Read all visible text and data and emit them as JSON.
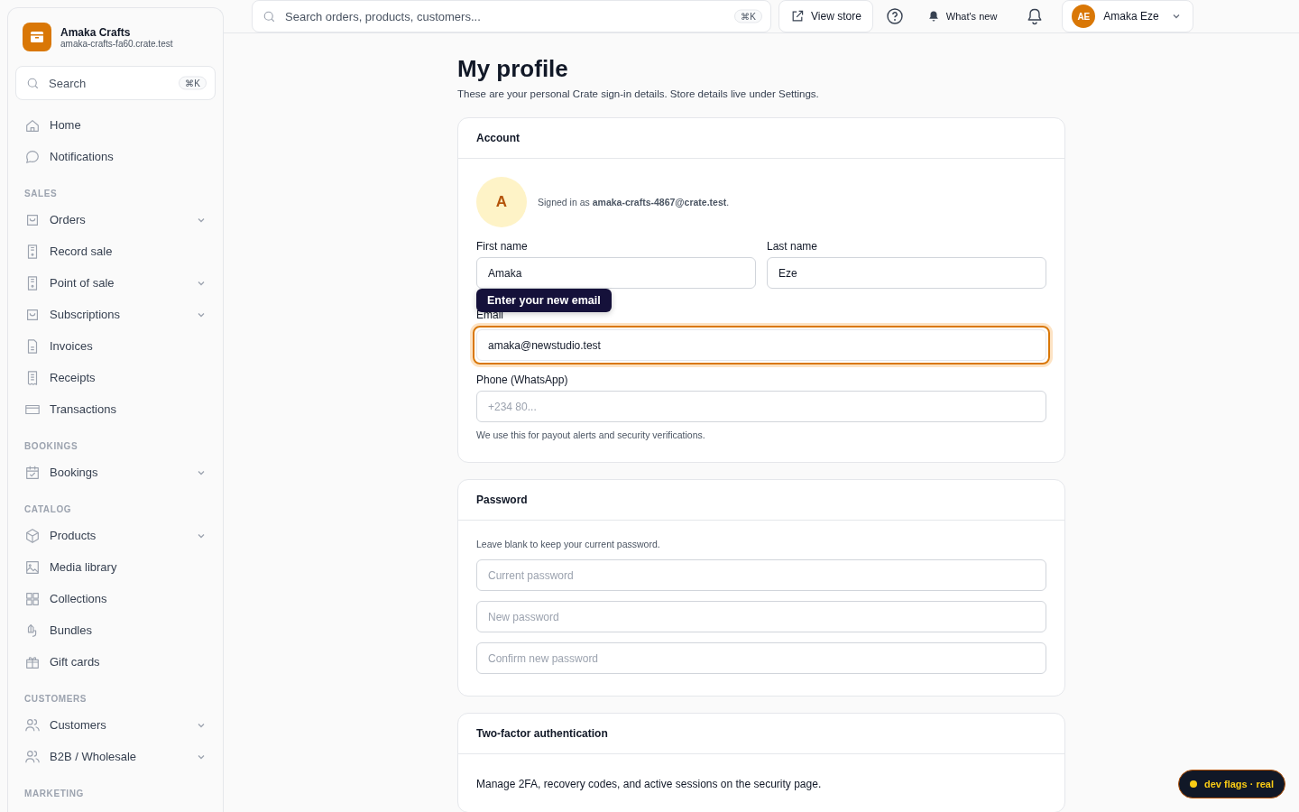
{
  "brand": {
    "name": "Amaka Crafts",
    "domain": "amaka-crafts-fa60.crate.test"
  },
  "sidebar_search": {
    "placeholder": "Search",
    "shortcut": "⌘K"
  },
  "nav_top": [
    {
      "label": "Home",
      "expandable": false
    },
    {
      "label": "Notifications",
      "expandable": false
    }
  ],
  "nav_sections": [
    {
      "title": "SALES",
      "items": [
        {
          "label": "Orders",
          "expandable": true
        },
        {
          "label": "Record sale",
          "expandable": false
        },
        {
          "label": "Point of sale",
          "expandable": true
        },
        {
          "label": "Subscriptions",
          "expandable": true
        },
        {
          "label": "Invoices",
          "expandable": false
        },
        {
          "label": "Receipts",
          "expandable": false
        },
        {
          "label": "Transactions",
          "expandable": false
        }
      ]
    },
    {
      "title": "BOOKINGS",
      "items": [
        {
          "label": "Bookings",
          "expandable": true
        }
      ]
    },
    {
      "title": "CATALOG",
      "items": [
        {
          "label": "Products",
          "expandable": true
        },
        {
          "label": "Media library",
          "expandable": false
        },
        {
          "label": "Collections",
          "expandable": false
        },
        {
          "label": "Bundles",
          "expandable": false
        },
        {
          "label": "Gift cards",
          "expandable": false
        }
      ]
    },
    {
      "title": "CUSTOMERS",
      "items": [
        {
          "label": "Customers",
          "expandable": true
        },
        {
          "label": "B2B / Wholesale",
          "expandable": true
        }
      ]
    },
    {
      "title": "MARKETING"
    }
  ],
  "topbar": {
    "search": {
      "placeholder": "Search orders, products, customers...",
      "shortcut": "⌘K"
    },
    "view_store": "View store",
    "whats_new": "What's new",
    "user": {
      "initials": "AE",
      "name": "Amaka Eze"
    }
  },
  "page": {
    "title": "My profile",
    "subtitle": "These are your personal Crate sign-in details. Store details live under Settings."
  },
  "account": {
    "header": "Account",
    "avatar_letter": "A",
    "signed_in": "Signed in as **amaka-crafts-4867@crate.test**.",
    "name_fields": [
      {
        "label": "First name",
        "value": "Amaka"
      },
      {
        "label": "Last name",
        "value": "Eze"
      }
    ],
    "email": {
      "label": "Email",
      "value": "amaka@newstudio.test",
      "focused": true,
      "tooltip": "Enter your new email"
    },
    "phone": {
      "label": "Phone (WhatsApp)",
      "placeholder": "+234 80...",
      "hint": "We use this for payout alerts and security verifications."
    }
  },
  "password": {
    "header": "Password",
    "hint": "Leave blank to keep your current password.",
    "fields": [
      {
        "placeholder": "Current password"
      },
      {
        "placeholder": "New password"
      },
      {
        "placeholder": "Confirm new password"
      }
    ]
  },
  "two_factor": {
    "header": "Two-factor authentication",
    "text": "Manage 2FA, recovery codes, and active sessions on the security page."
  },
  "dev_badge": "dev flags · real"
}
